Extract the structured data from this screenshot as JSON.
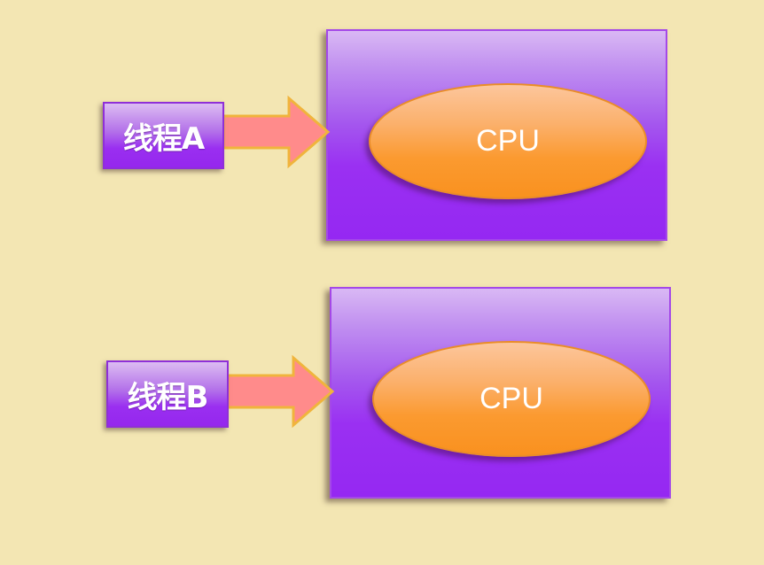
{
  "rows": [
    {
      "thread_label": "线程A",
      "cpu_label": "CPU"
    },
    {
      "thread_label": "线程B",
      "cpu_label": "CPU"
    }
  ],
  "colors": {
    "background": "#f3e6b3",
    "thread_box_fill": "#9a2ff0",
    "cpu_box_fill": "#9528f2",
    "cpu_ellipse_fill": "#f9911f",
    "arrow_fill": "#ff8b8b",
    "arrow_stroke": "#f0b43c"
  }
}
